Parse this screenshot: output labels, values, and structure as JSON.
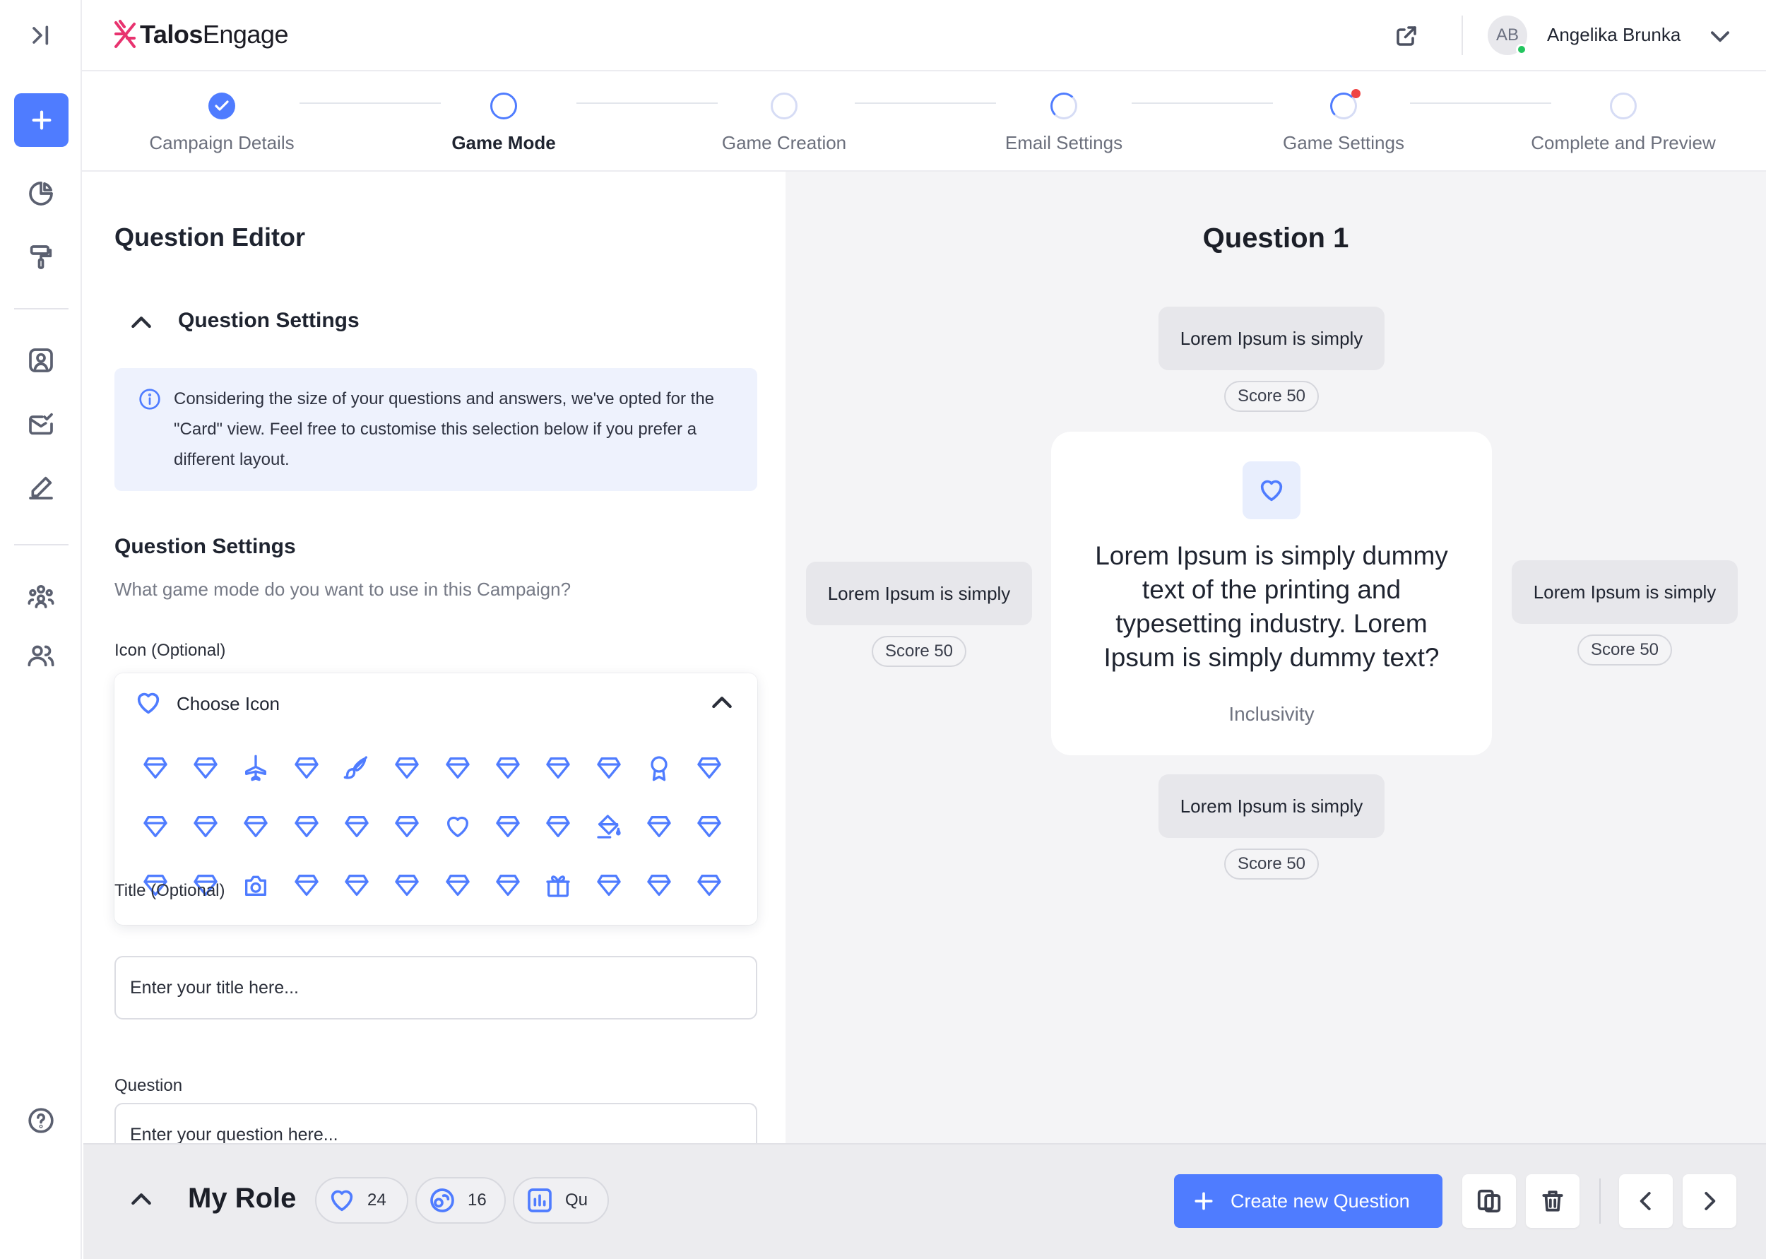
{
  "brand": {
    "name_bold": "Talos",
    "name_light": "Engage",
    "accent": "#4f7cff",
    "logo_color": "#e8336f"
  },
  "user": {
    "initials": "AB",
    "name": "Angelika Brunka",
    "status_color": "#22c55e"
  },
  "sidebar": {
    "items": [
      {
        "icon": "expand-sidebar-icon"
      },
      {
        "icon": "plus-icon",
        "primary": true
      },
      {
        "icon": "pie-chart-icon"
      },
      {
        "icon": "paint-roller-icon"
      },
      {
        "icon": "user-square-icon"
      },
      {
        "icon": "mail-check-icon"
      },
      {
        "icon": "pen-icon"
      },
      {
        "icon": "team-icon"
      },
      {
        "icon": "users-icon"
      },
      {
        "icon": "help-icon"
      }
    ]
  },
  "stepper": {
    "steps": [
      {
        "label": "Campaign Details",
        "state": "done"
      },
      {
        "label": "Game Mode",
        "state": "active"
      },
      {
        "label": "Game Creation",
        "state": "empty"
      },
      {
        "label": "Email Settings",
        "state": "partial"
      },
      {
        "label": "Game Settings",
        "state": "partial-alert"
      },
      {
        "label": "Complete and Preview",
        "state": "empty"
      }
    ]
  },
  "editor": {
    "title": "Question Editor",
    "accordion_title": "Question Settings",
    "info_text": "Considering the size of your questions and answers, we've opted for the \"Card\" view. Feel free to customise this selection below if you prefer a different layout.",
    "section_title": "Question Settings",
    "section_subtitle": "What game mode do you want to use in this Campaign?",
    "icon_label": "Icon (Optional)",
    "icon_picker_label": "Choose Icon",
    "icon_grid": [
      "gem",
      "gem",
      "plane",
      "gem",
      "brush",
      "gem",
      "gem",
      "gem",
      "gem",
      "gem",
      "award",
      "gem",
      "gem",
      "gem",
      "gem",
      "gem",
      "gem",
      "gem",
      "heart",
      "gem",
      "gem",
      "paint-bucket",
      "gem",
      "gem",
      "gem",
      "gem",
      "camera",
      "gem",
      "gem",
      "gem",
      "gem",
      "gem",
      "gift",
      "gem",
      "gem",
      "gem"
    ],
    "title_label": "Title (Optional)",
    "title_placeholder": "Enter your title here...",
    "question_label": "Question",
    "question_placeholder": "Enter your question here..."
  },
  "preview": {
    "title": "Question 1",
    "question_text": "Lorem Ipsum is simply dummy text of the printing and typesetting industry. Lorem Ipsum is simply dummy text?",
    "category": "Inclusivity",
    "answers": [
      {
        "text": "Lorem Ipsum is simply",
        "score": "Score 50"
      },
      {
        "text": "Lorem Ipsum is simply",
        "score": "Score 50"
      },
      {
        "text": "Lorem Ipsum is simply",
        "score": "Score 50"
      },
      {
        "text": "Lorem Ipsum is simply",
        "score": "Score 50"
      }
    ]
  },
  "footer": {
    "title": "My Role",
    "chips": [
      {
        "icon": "heart-icon",
        "text": "24"
      },
      {
        "icon": "coins-icon",
        "text": "16"
      },
      {
        "icon": "bar-chart-icon",
        "text": "Qu"
      }
    ],
    "create_label": "Create new Question"
  }
}
